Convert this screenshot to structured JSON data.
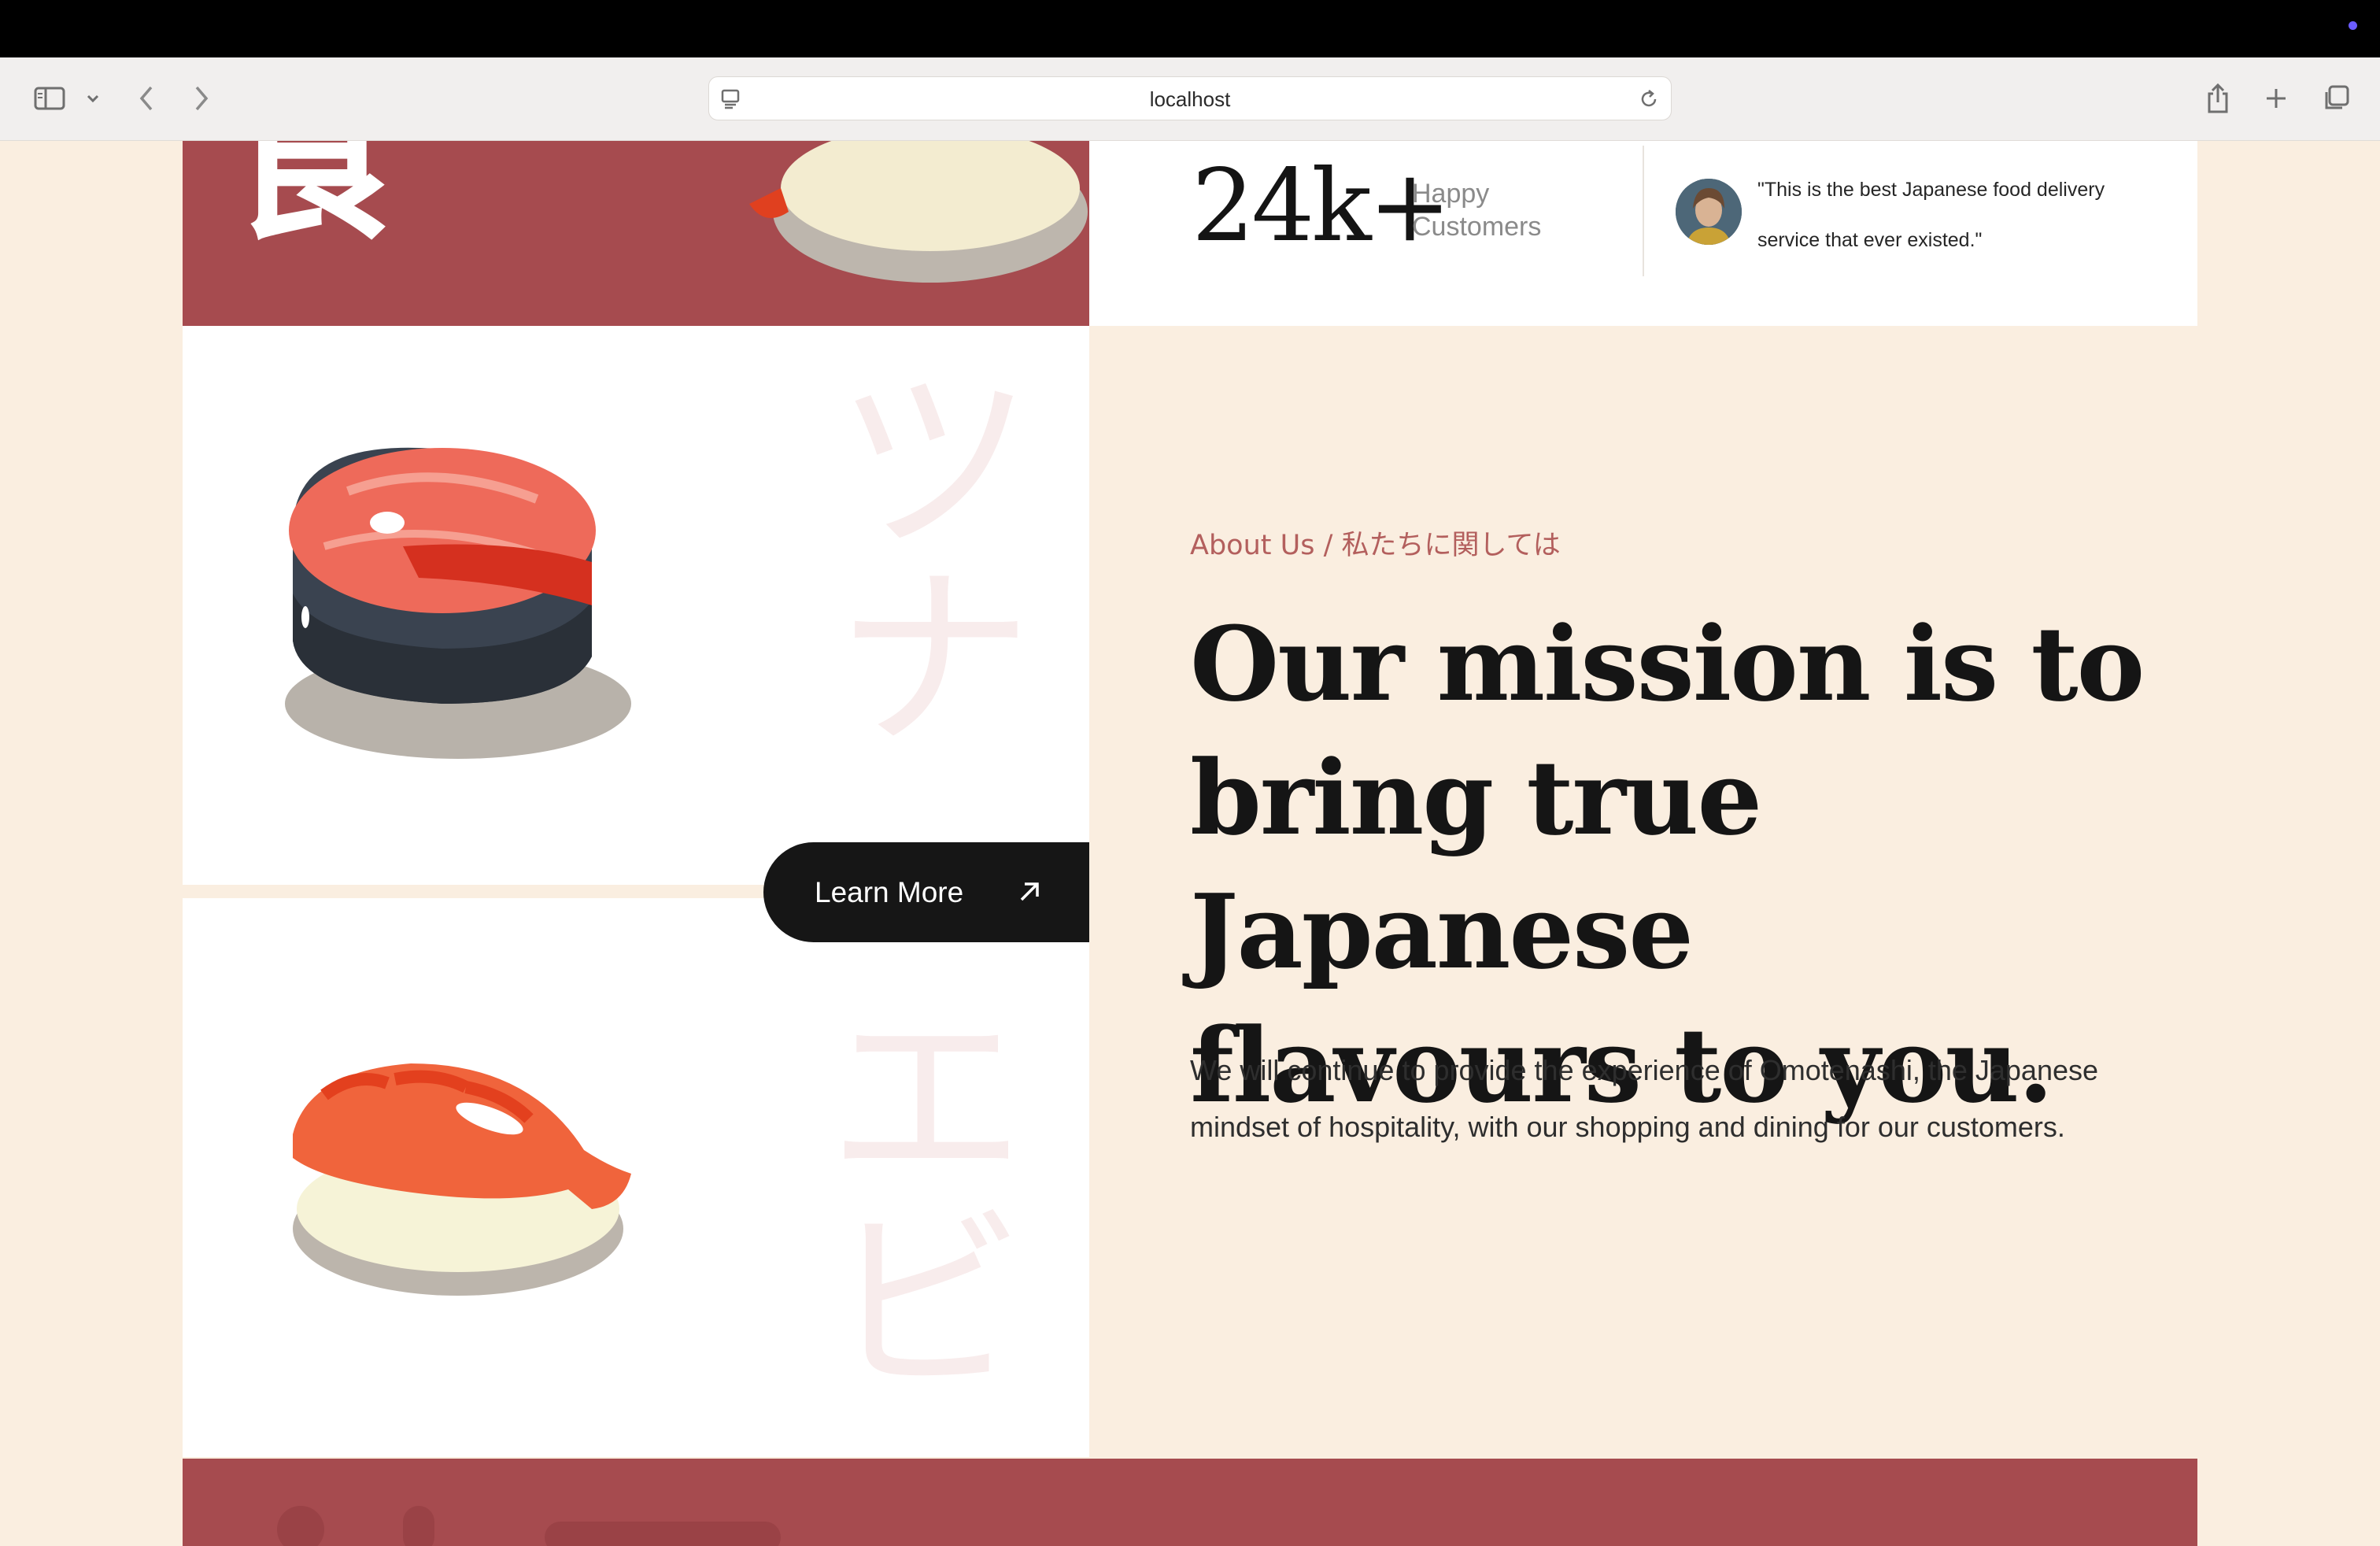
{
  "browser": {
    "url": "localhost"
  },
  "hero": {
    "kanji": "食"
  },
  "stats": {
    "number": "24k+",
    "label": "Happy Customers",
    "quote": "\"This is the best Japanese food delivery service that ever existed.\""
  },
  "cards": {
    "tuna_kanji": "ツナ",
    "shrimp_kanji": "エビ"
  },
  "cta": {
    "label": "Learn More"
  },
  "about": {
    "label": "About Us / 私たちに関しては",
    "headline": "Our mission is to bring true Japanese flavours to you.",
    "body": "We will continue to provide the experience of Omotenashi, the Japanese mindset of hospitality, with our shopping and dining for our customers."
  },
  "colors": {
    "brand_red": "#a64b4f",
    "cream": "#faeee0",
    "dark": "#161616",
    "accent_text": "#b35f5d"
  },
  "icons": [
    "sidebar-icon",
    "chevron-down-icon",
    "back-arrow-icon",
    "forward-arrow-icon",
    "page-icon",
    "reload-icon",
    "share-icon",
    "new-tab-icon",
    "tabs-overview-icon",
    "arrow-up-right-icon"
  ]
}
